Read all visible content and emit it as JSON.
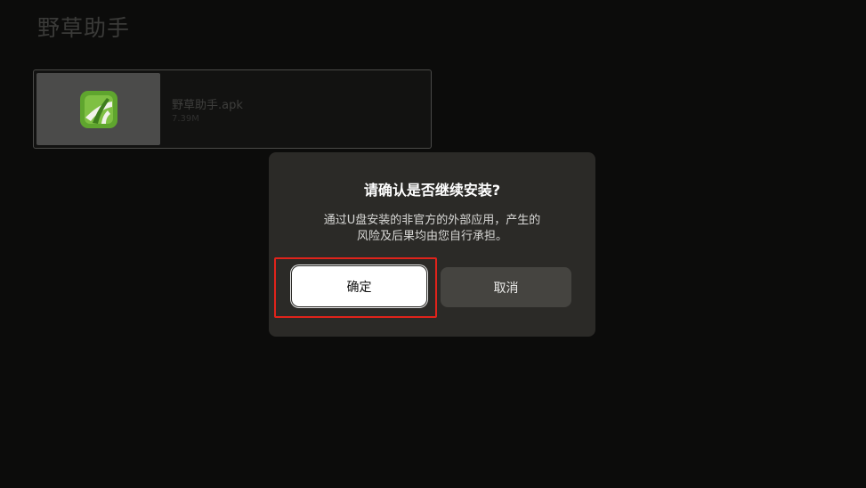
{
  "header": {
    "title": "野草助手"
  },
  "file": {
    "name": "野草助手.apk",
    "size": "7.39M",
    "icon": "app-icon-green-leaf"
  },
  "dialog": {
    "title": "请确认是否继续安装?",
    "message_line1": "通过U盘安装的非官方的外部应用，产生的",
    "message_line2": "风险及后果均由您自行承担。",
    "confirm_label": "确定",
    "cancel_label": "取消"
  },
  "colors": {
    "background": "#0c0c0b",
    "dialog": "#2b2a27",
    "confirm_button": "#ffffff",
    "cancel_button": "#454440",
    "highlight": "#e0231b",
    "app_icon_green": "#5fa52e"
  }
}
